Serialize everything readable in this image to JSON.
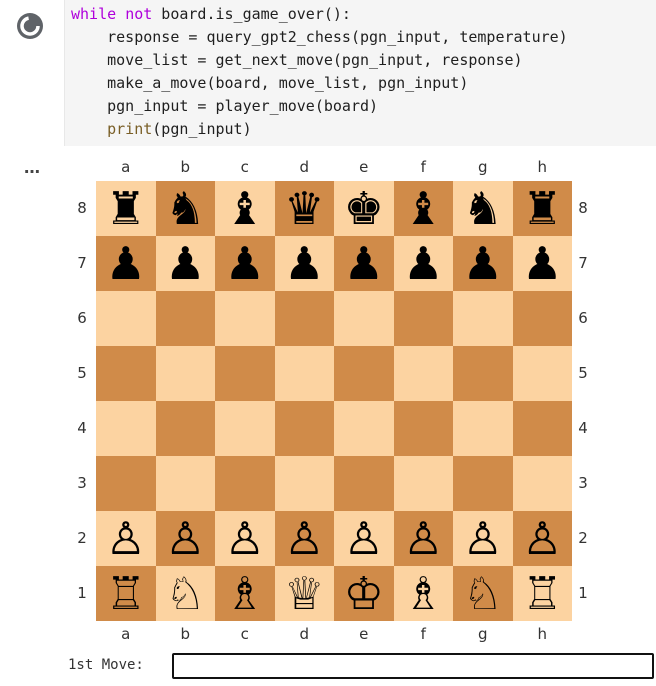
{
  "code_cell": {
    "lines": [
      "while not board.is_game_over():",
      "    response = query_gpt2_chess(pgn_input, temperature)",
      "    move_list = get_next_move(pgn_input, response)",
      "    make_a_move(board, move_list, pgn_input)",
      "    pgn_input = player_move(board)",
      "    print(pgn_input)"
    ],
    "run_icon": "circle-spinner-icon"
  },
  "output_menu": "…",
  "board": {
    "files": [
      "a",
      "b",
      "c",
      "d",
      "e",
      "f",
      "g",
      "h"
    ],
    "ranks": [
      "8",
      "7",
      "6",
      "5",
      "4",
      "3",
      "2",
      "1"
    ],
    "colors": {
      "light": "#fcd3a1",
      "dark": "#d08b49"
    },
    "rows": [
      [
        "♜",
        "♞",
        "♝",
        "♛",
        "♚",
        "♝",
        "♞",
        "♜"
      ],
      [
        "♟",
        "♟",
        "♟",
        "♟",
        "♟",
        "♟",
        "♟",
        "♟"
      ],
      [
        "",
        "",
        "",
        "",
        "",
        "",
        "",
        ""
      ],
      [
        "",
        "",
        "",
        "",
        "",
        "",
        "",
        ""
      ],
      [
        "",
        "",
        "",
        "",
        "",
        "",
        "",
        ""
      ],
      [
        "",
        "",
        "",
        "",
        "",
        "",
        "",
        ""
      ],
      [
        "♙",
        "♙",
        "♙",
        "♙",
        "♙",
        "♙",
        "♙",
        "♙"
      ],
      [
        "♖",
        "♘",
        "♗",
        "♕",
        "♔",
        "♗",
        "♘",
        "♖"
      ]
    ]
  },
  "move_prompt": {
    "label": "1st Move:",
    "value": "",
    "placeholder": ""
  }
}
